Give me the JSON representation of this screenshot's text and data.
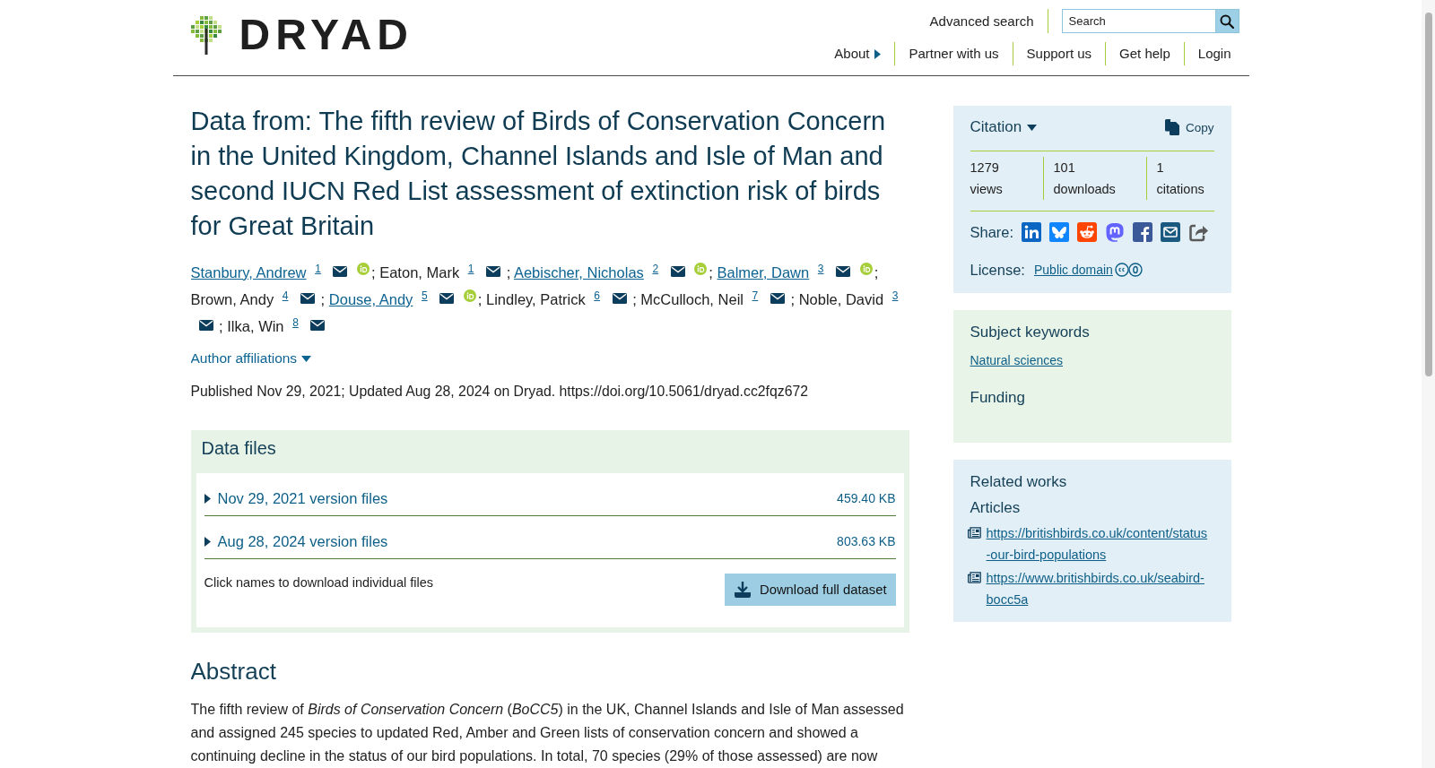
{
  "header": {
    "logo": "DRYAD",
    "utility_links": [
      "Advanced search"
    ],
    "search": {
      "placeholder": "Search"
    },
    "nav": [
      {
        "label": "About",
        "submenu": true
      },
      {
        "label": "Partner with us",
        "submenu": false
      },
      {
        "label": "Support us",
        "submenu": false
      },
      {
        "label": "Get help",
        "submenu": false
      },
      {
        "label": "Login",
        "submenu": false
      }
    ]
  },
  "dataset": {
    "title": "Data from: The fifth review of Birds of Conservation Concern in the United Kingdom, Channel Islands and Isle of Man and second IUCN Red List assessment of extinction risk of birds for Great Britain",
    "authors": {
      "separator": ";",
      "items": [
        {
          "name": "Stanbury, Andrew",
          "linked": true,
          "affiliation": "1",
          "email": true,
          "orcid": true
        },
        {
          "name": "Eaton, Mark",
          "linked": false,
          "affiliation": "1",
          "email": true,
          "orcid": false
        },
        {
          "name": "Aebischer, Nicholas",
          "linked": true,
          "affiliation": "2",
          "email": true,
          "orcid": true
        },
        {
          "name": "Balmer, Dawn",
          "linked": true,
          "affiliation": "3",
          "email": true,
          "orcid": true
        },
        {
          "name": "Brown, Andy",
          "linked": false,
          "affiliation": "4",
          "email": true,
          "orcid": false
        },
        {
          "name": "Douse, Andy",
          "linked": true,
          "affiliation": "5",
          "email": true,
          "orcid": true
        },
        {
          "name": "Lindley, Patrick",
          "linked": false,
          "affiliation": "6",
          "email": true,
          "orcid": false
        },
        {
          "name": "McCulloch, Neil",
          "linked": false,
          "affiliation": "7",
          "email": true,
          "orcid": false
        },
        {
          "name": "Noble, David",
          "linked": false,
          "affiliation": "3",
          "email": true,
          "orcid": false
        },
        {
          "name": "Ilka, Win",
          "linked": false,
          "affiliation": "8",
          "email": true,
          "orcid": false
        }
      ]
    },
    "affiliations_toggle": "Author affiliations",
    "published": "Published Nov 29, 2021; Updated Aug 28, 2024 on Dryad. https://doi.org/10.5061/dryad.cc2fqz672"
  },
  "data_files": {
    "title": "Data files",
    "versions": [
      {
        "label": "Nov 29, 2021 version files",
        "size": "459.40 KB",
        "expanded": false
      },
      {
        "label": "Aug 28, 2024 version files",
        "size": "803.63 KB",
        "expanded": false
      }
    ],
    "hint": "Click names to download individual files",
    "download_button": "Download full dataset"
  },
  "abstract": {
    "title": "Abstract",
    "text": "The fifth review of *Birds of Conservation Concern* (*BoCC5*) in the UK, Channel Islands and Isle of Man assessed and assigned 245 species to updated Red, Amber and Green lists of conservation concern and showed a continuing decline in the status of our bird populations. In total, 70 species (29% of those assessed) are now"
  },
  "sidebar": {
    "citation": {
      "label": "Citation",
      "copy": "Copy"
    },
    "metrics": [
      {
        "value": "1279",
        "label": "views"
      },
      {
        "value": "101",
        "label": "downloads"
      },
      {
        "value": "1",
        "label": "citations"
      }
    ],
    "share_label": "Share:",
    "license": {
      "label": "License:",
      "link": "Public domain"
    },
    "keywords": {
      "title": "Subject keywords",
      "items": [
        "Natural sciences"
      ]
    },
    "funding": {
      "title": "Funding"
    },
    "related_works": {
      "title": "Related works",
      "groups": [
        {
          "title": "Articles",
          "links": [
            "https://britishbirds.co.uk/content/status-our-bird-populations",
            "https://www.britishbirds.co.uk/seabird-bocc5a"
          ]
        }
      ]
    }
  }
}
